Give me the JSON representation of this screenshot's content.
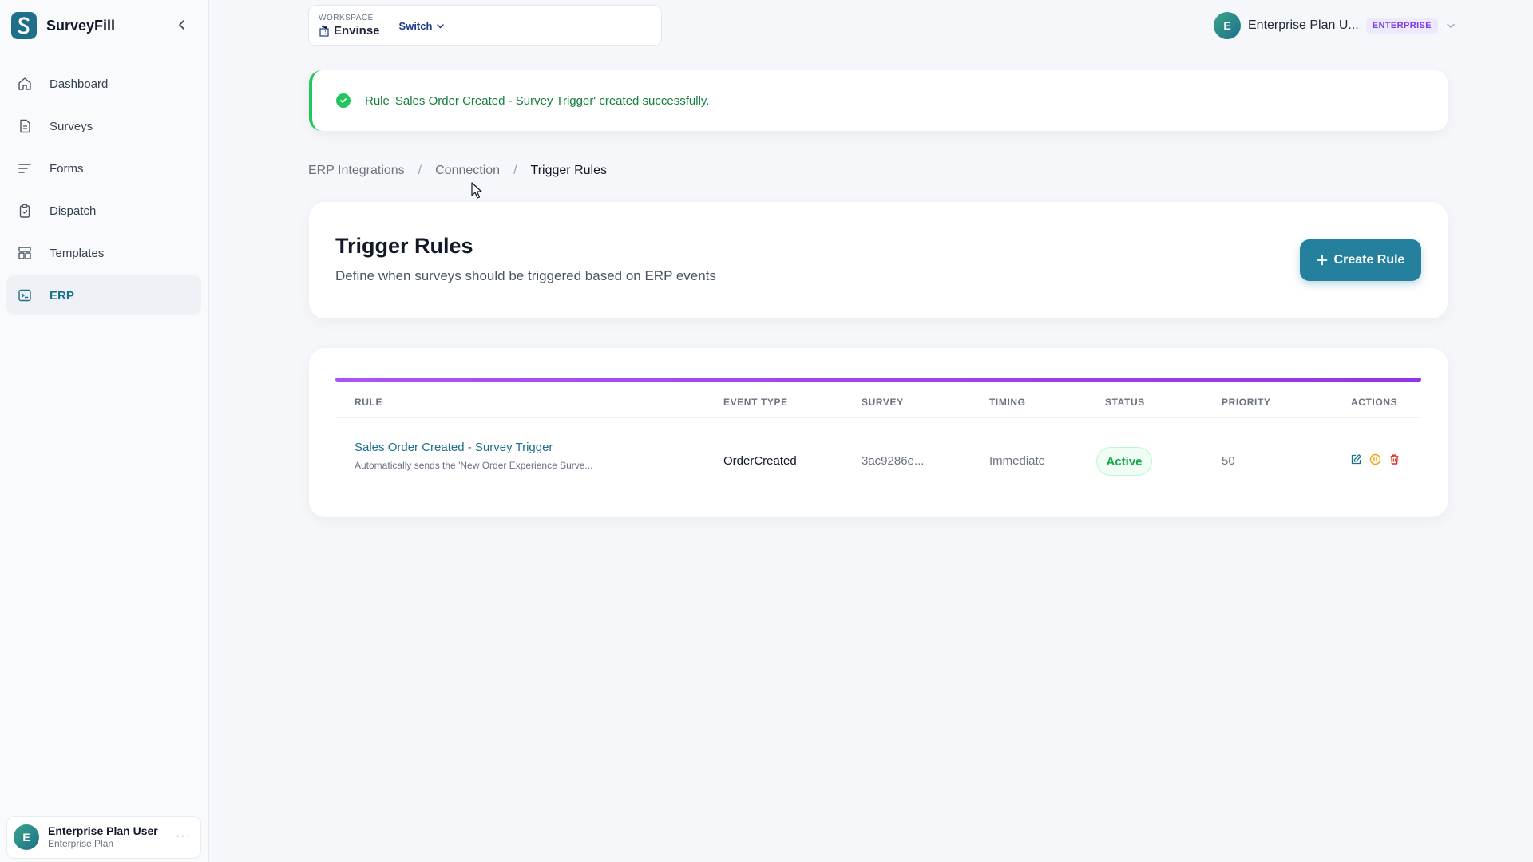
{
  "app": {
    "name": "SurveyFill"
  },
  "sidebar": {
    "items": [
      {
        "label": "Dashboard",
        "icon": "home-icon"
      },
      {
        "label": "Surveys",
        "icon": "document-icon"
      },
      {
        "label": "Forms",
        "icon": "list-icon"
      },
      {
        "label": "Dispatch",
        "icon": "clipboard-icon"
      },
      {
        "label": "Templates",
        "icon": "templates-icon"
      },
      {
        "label": "ERP",
        "icon": "terminal-icon",
        "active": true
      }
    ],
    "user": {
      "initial": "E",
      "name": "Enterprise Plan User",
      "plan": "Enterprise Plan",
      "more": "···"
    }
  },
  "topbar": {
    "workspace": {
      "caption": "WORKSPACE",
      "name": "Envinse",
      "switch_label": "Switch"
    },
    "user": {
      "initial": "E",
      "name": "Enterprise Plan U...",
      "badge": "ENTERPRISE"
    }
  },
  "alert": {
    "message": "Rule 'Sales Order Created - Survey Trigger' created successfully."
  },
  "breadcrumb": [
    {
      "label": "ERP Integrations"
    },
    {
      "label": "Connection"
    },
    {
      "label": "Trigger Rules"
    }
  ],
  "breadcrumb_sep": "/",
  "header": {
    "title": "Trigger Rules",
    "subtitle": "Define when surveys should be triggered based on ERP events",
    "create_label": "Create Rule"
  },
  "table": {
    "columns": [
      "RULE",
      "EVENT TYPE",
      "SURVEY",
      "TIMING",
      "STATUS",
      "PRIORITY",
      "ACTIONS"
    ],
    "rows": [
      {
        "name": "Sales Order Created - Survey Trigger",
        "description": "Automatically sends the 'New Order Experience Surve...",
        "event_type": "OrderCreated",
        "survey": "3ac9286e...",
        "timing": "Immediate",
        "status": "Active",
        "priority": "50"
      }
    ]
  },
  "colors": {
    "accent": "#24809c",
    "success": "#22c55e",
    "table_accent": "#9333ea",
    "badge_purple": "#7c3aed",
    "delete": "#dc2626",
    "toggle": "#f59e0b"
  }
}
